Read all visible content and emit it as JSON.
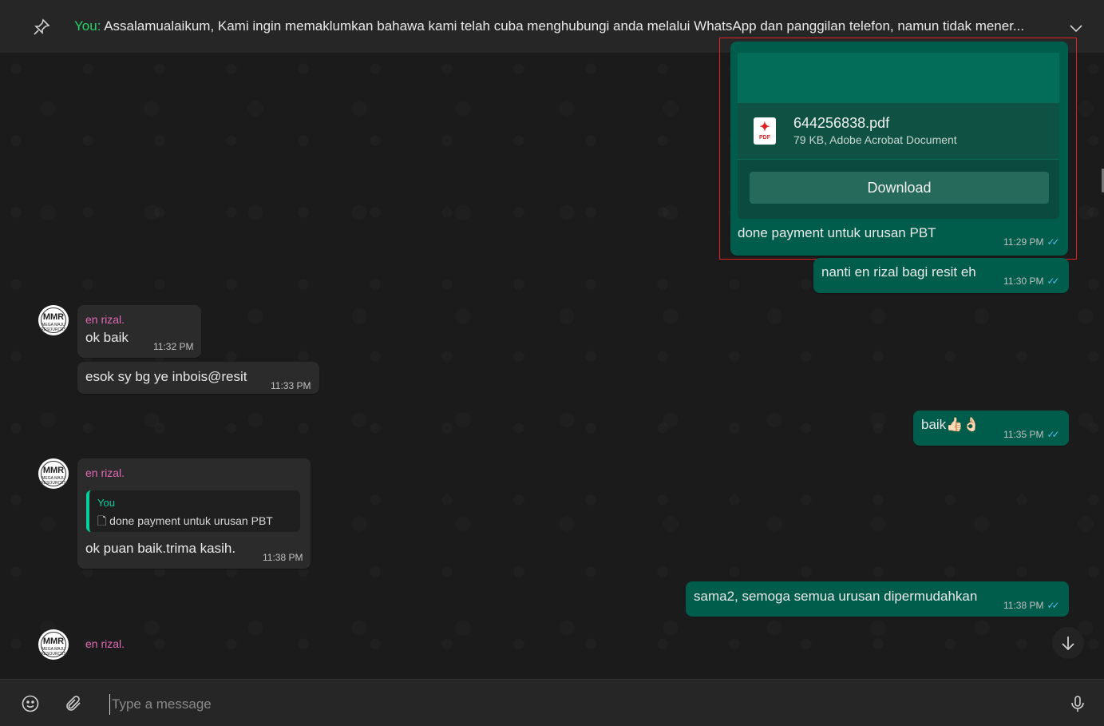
{
  "pinned": {
    "sender": "You:",
    "text": "Assalamualaikum,  Kami ingin memaklumkan bahawa kami telah cuba menghubungi anda melalui WhatsApp dan panggilan telefon, namun tidak mener..."
  },
  "document": {
    "file_name": "644256838.pdf",
    "file_meta": "79 KB, Adobe Acrobat Document",
    "icon_label": "PDF",
    "download_label": "Download",
    "caption": "done payment untuk urusan PBT",
    "time": "11:29 PM"
  },
  "messages": {
    "m1": {
      "text": "nanti en rizal bagi resit eh",
      "time": "11:30 PM"
    },
    "m2": {
      "sender": "en rizal.",
      "text": "ok baik",
      "time": "11:32 PM"
    },
    "m3": {
      "text": "esok sy bg ye inbois@resit",
      "time": "11:33 PM"
    },
    "m4": {
      "text": "baik👍🏻👌🏻",
      "time": "11:35 PM"
    },
    "m5": {
      "sender": "en rizal.",
      "quote_author": "You",
      "quote_text": "done payment untuk urusan PBT",
      "text": "ok puan baik.trima kasih.",
      "time": "11:38 PM"
    },
    "m6": {
      "text": "sama2, semoga semua urusan dipermudahkan",
      "time": "11:38 PM"
    },
    "m7": {
      "sender": "en rizal."
    }
  },
  "avatar": {
    "initials": "MMR",
    "subtitle": "MEGA MAJU RESOURCES"
  },
  "composer": {
    "placeholder": "Type a message"
  },
  "colors": {
    "outgoing_bubble": "#005c4b",
    "incoming_bubble": "#2b2b2b",
    "sender_name": "#e26ab6",
    "read_ticks": "#53bdeb",
    "accent": "#25d366"
  },
  "icons": {
    "pin": "pin-icon",
    "chevron": "chevron-down-icon",
    "emoji": "emoji-icon",
    "attach": "paperclip-icon",
    "mic": "microphone-icon",
    "scroll": "arrow-down-icon"
  }
}
